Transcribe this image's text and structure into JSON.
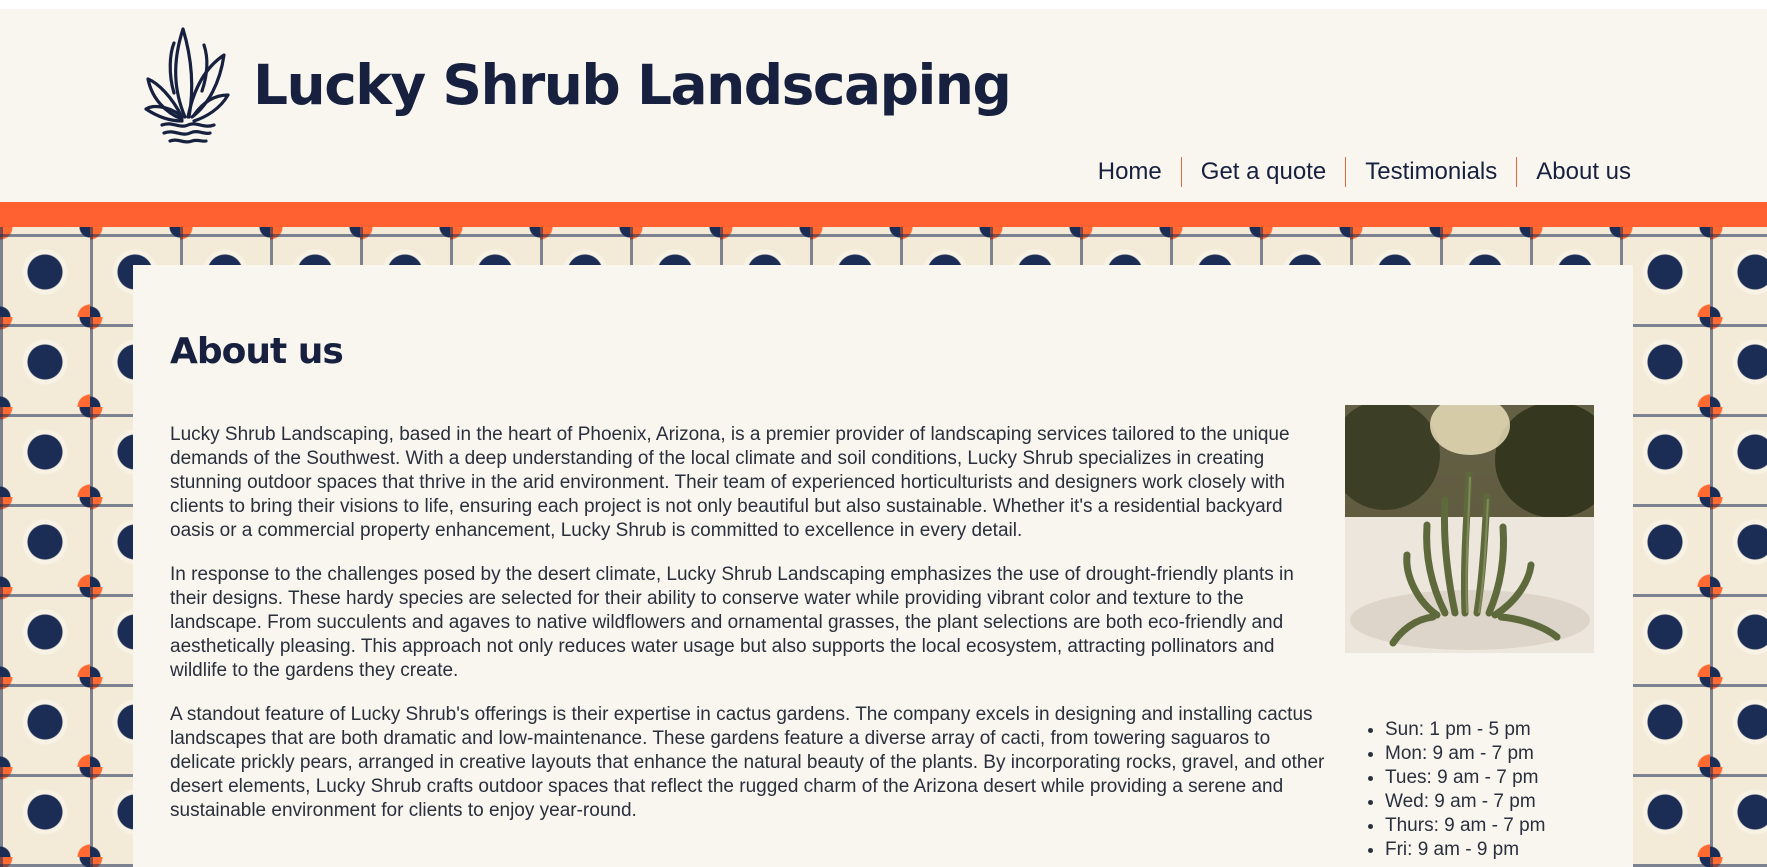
{
  "colors": {
    "navy": "#17213f",
    "orange": "#ff6230",
    "cream": "#f8f6ee",
    "teal": "#4cc2c0"
  },
  "header": {
    "logo_icon": "agave-plant-logo",
    "site_title": "Lucky Shrub Landscaping"
  },
  "nav": {
    "items": [
      {
        "label": "Home"
      },
      {
        "label": "Get a quote"
      },
      {
        "label": "Testimonials"
      },
      {
        "label": "About us"
      }
    ]
  },
  "main": {
    "heading": "About us",
    "paragraphs": [
      "Lucky Shrub Landscaping, based in the heart of Phoenix, Arizona, is a premier provider of landscaping services tailored to the unique demands of the Southwest. With a deep understanding of the local climate and soil conditions, Lucky Shrub specializes in creating stunning outdoor spaces that thrive in the arid environment. Their team of experienced horticulturists and designers work closely with clients to bring their visions to life, ensuring each project is not only beautiful but also sustainable. Whether it's a residential backyard oasis or a commercial property enhancement, Lucky Shrub is committed to excellence in every detail.",
      "In response to the challenges posed by the desert climate, Lucky Shrub Landscaping emphasizes the use of drought-friendly plants in their designs. These hardy species are selected for their ability to conserve water while providing vibrant color and texture to the landscape. From succulents and agaves to native wildflowers and ornamental grasses, the plant selections are both eco-friendly and aesthetically pleasing. This approach not only reduces water usage but also supports the local ecosystem, attracting pollinators and wildlife to the gardens they create.",
      "A standout feature of Lucky Shrub's offerings is their expertise in cactus gardens. The company excels in designing and installing cactus landscapes that are both dramatic and low-maintenance. These gardens feature a diverse array of cacti, from towering saguaros to delicate prickly pears, arranged in creative layouts that enhance the natural beauty of the plants. By incorporating rocks, gravel, and other desert elements, Lucky Shrub crafts outdoor spaces that reflect the rugged charm of the Arizona desert while providing a serene and sustainable environment for clients to enjoy year-round."
    ],
    "photo_icon": "cactus-photo"
  },
  "hours": [
    "Sun: 1 pm - 5 pm",
    "Mon: 9 am - 7 pm",
    "Tues: 9 am - 7 pm",
    "Wed: 9 am - 7 pm",
    "Thurs: 9 am - 7 pm",
    "Fri: 9 am - 9 pm"
  ]
}
